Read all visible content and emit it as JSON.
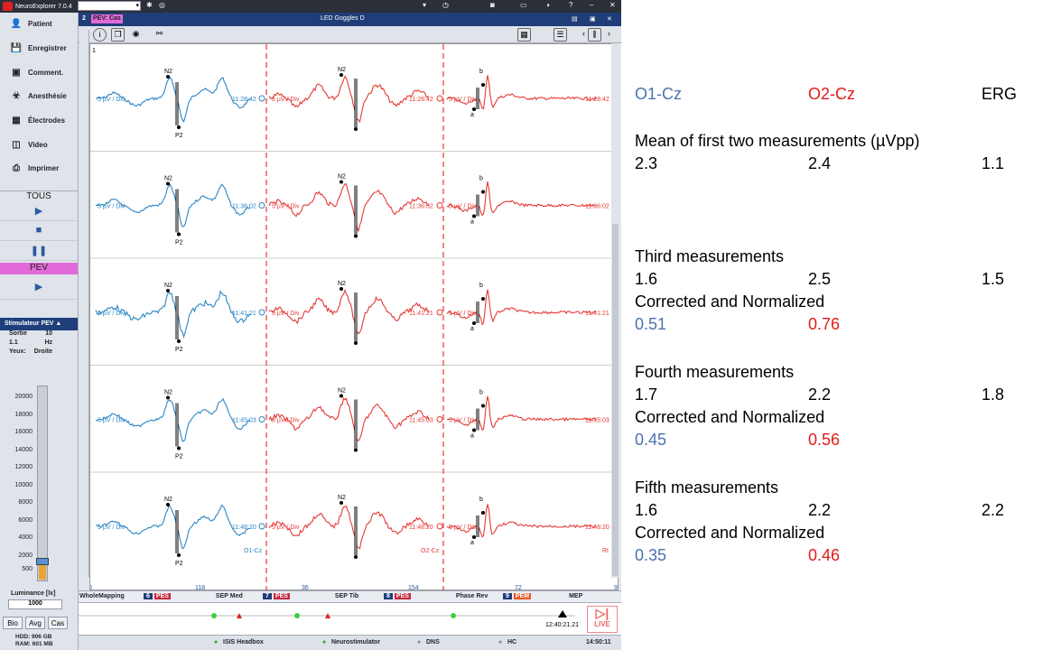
{
  "app": {
    "title": "NeuroExplorer  7.0.4",
    "header_number": "2",
    "header_badge": "PEV: Cas",
    "stimulus_title": "LED Goggles D"
  },
  "sidebar": {
    "items": [
      {
        "label": "Patient",
        "icon": "person-icon"
      },
      {
        "label": "Enregistrer",
        "icon": "save-icon"
      },
      {
        "label": "Comment.",
        "icon": "comment-icon"
      },
      {
        "label": "Anesthésie",
        "icon": "anesthesia-icon"
      },
      {
        "label": "Électrodes",
        "icon": "electrodes-icon"
      },
      {
        "label": "Video",
        "icon": "video-icon"
      },
      {
        "label": "Imprimer",
        "icon": "print-icon"
      }
    ],
    "tous_label": "TOUS",
    "pev_label": "PEV",
    "stim_header": "Stimulateur PEV",
    "stim_rows": [
      {
        "label": "Sortie",
        "value": "10"
      },
      {
        "label": "1.1",
        "value": "Hz"
      },
      {
        "label": "Yeux:",
        "value": "Droite"
      }
    ],
    "scale_ticks": [
      "20000",
      "18000",
      "16000",
      "14000",
      "12000",
      "10000",
      "8000",
      "6000",
      "4000",
      "2000",
      "500"
    ],
    "luminance_label": "Luminance [lx]",
    "luminance_value": "1000",
    "luminance_fraction": 0.04,
    "bottom_tabs": [
      "Bio",
      "Avg",
      "Cas"
    ],
    "hdd": "HDD: 906 GB",
    "ram": "RAM: 601 MB"
  },
  "traces": {
    "timestamps": [
      "11:28:42",
      "11:36:02",
      "11:41:21",
      "11:45:03",
      "11:48:20"
    ],
    "gain_label": "5 µV / Div",
    "channel_left": "O1-Cz",
    "channel_right": "O2-Cz",
    "channel_erg": "Rt",
    "peak_n2": "N2",
    "peak_p2": "P2",
    "peak_a": "a",
    "peak_b": "b",
    "marker_number": "1",
    "colors": {
      "blue": "#2b86c5",
      "red": "#e53935",
      "divider": "#e53935"
    }
  },
  "xaxis": {
    "ticks": [
      "0",
      "118",
      "36",
      "154",
      "72",
      "9"
    ]
  },
  "bottom_tabs": [
    {
      "label": "WholeMapping"
    },
    {
      "num": "6",
      "tag": "PES",
      "label": "SEP Med"
    },
    {
      "num": "7",
      "tag": "PES",
      "label": "SEP Tib"
    },
    {
      "num": "8",
      "tag": "PES",
      "label": "Phase Rev"
    },
    {
      "num": "9",
      "tag": "PEM",
      "label": "MEP"
    }
  ],
  "timeline": {
    "time": "12:40:21.21",
    "live_label": "LIVE"
  },
  "statusbar": {
    "items": [
      "ISIS Headbox",
      "Neurostimulator",
      "DNS",
      "HC"
    ],
    "clock": "14:50:11"
  },
  "results": {
    "headers": {
      "o1": "O1-Cz",
      "o2": "O2-Cz",
      "erg": "ERG"
    },
    "mean_title": "Mean of first two measurements (µVpp)",
    "mean": {
      "o1": "2.3",
      "o2": "2.4",
      "erg": "1.1"
    },
    "corrected_label": "Corrected and Normalized",
    "blocks": [
      {
        "title": "Third measurements",
        "o1": "1.6",
        "o2": "2.5",
        "erg": "1.5",
        "c1": "0.51",
        "c2": "0.76"
      },
      {
        "title": "Fourth measurements",
        "o1": "1.7",
        "o2": "2.2",
        "erg": "1.8",
        "c1": "0.45",
        "c2": "0.56"
      },
      {
        "title": "Fifth measurements",
        "o1": "1.6",
        "o2": "2.2",
        "erg": "2.2",
        "c1": "0.35",
        "c2": "0.46"
      }
    ]
  }
}
